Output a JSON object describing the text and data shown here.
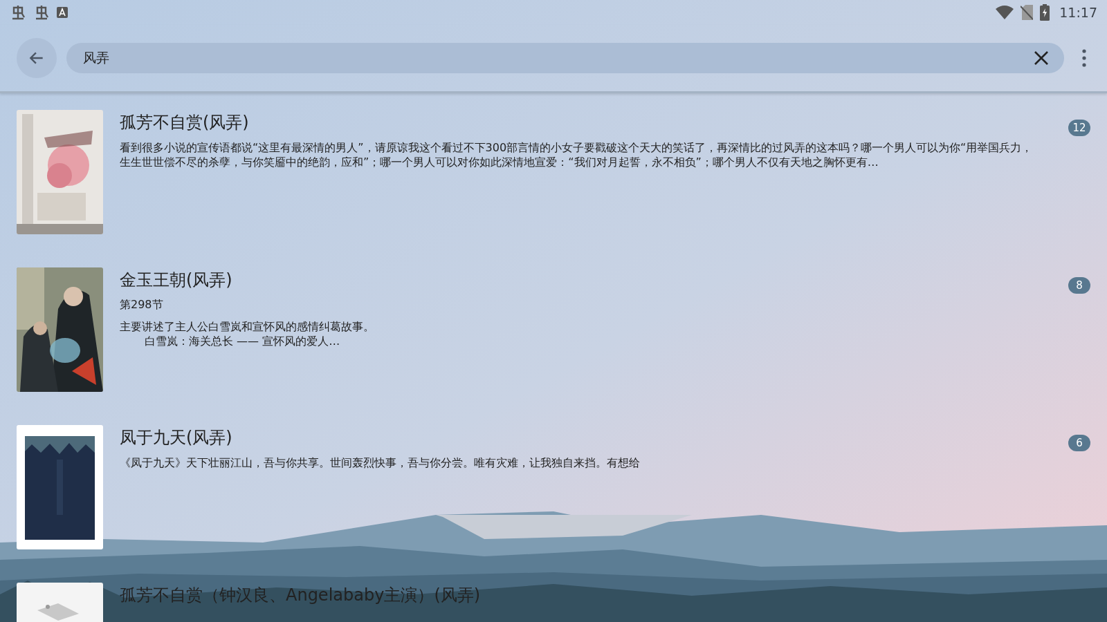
{
  "status_bar": {
    "time": "11:17"
  },
  "search": {
    "value": "风弄"
  },
  "results": [
    {
      "title": "孤芳不自赏(风弄)",
      "description": [
        "看到很多小说的宣传语都说“这里有最深情的男人”，请原谅我这个看过不下300部言情的小女子要戳破这个天大的笑话了，再深情比的过风弄的这本吗？哪一个男人可以为你“用举国兵力，生生世世偿不尽的杀孽，与你笑靥中的绝韵，应和”；哪一个男人可以对你如此深情地宣爱：“我们对月起誓，永不相负”；哪个男人不仅有天地之胸怀更有…"
      ],
      "count": "12"
    },
    {
      "title": "金玉王朝(风弄)",
      "subtitle": "第298节",
      "description": [
        "主要讲述了主人公白雪岚和宣怀风的感情纠葛故事。",
        "白雪岚：海关总长 —— 宣怀风的爱人…"
      ],
      "count": "8"
    },
    {
      "title": "凤于九天(风弄)",
      "description": [
        "《凤于九天》天下壮丽江山，吾与你共享。世间轰烈快事，吾与你分尝。唯有灾难，让我独自来挡。有想给"
      ],
      "count": "6"
    },
    {
      "title": "孤芳不自赏（钟汉良、Angelababy主演）(风弄)"
    }
  ]
}
